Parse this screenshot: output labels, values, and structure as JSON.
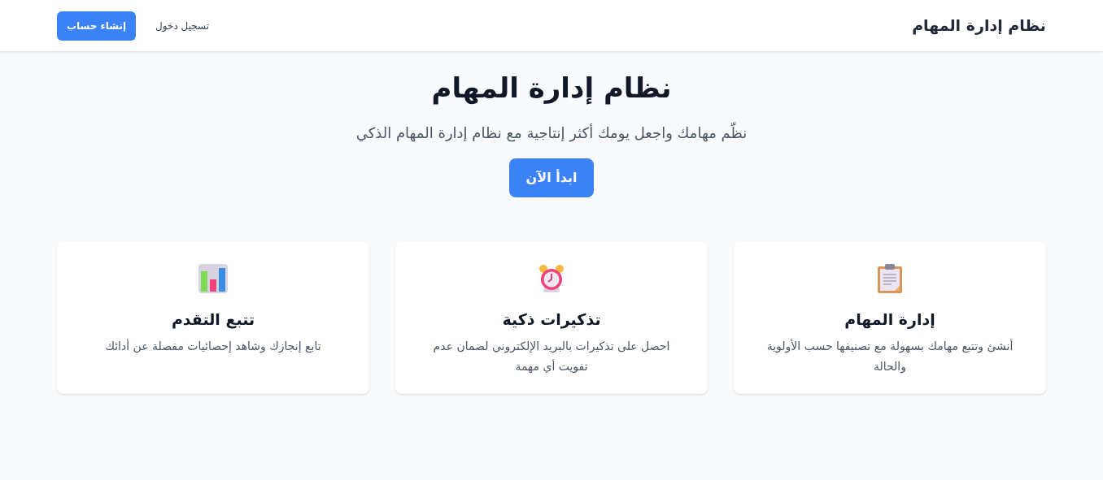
{
  "header": {
    "brand": "نظام إدارة المهام",
    "login": "تسجيل دخول",
    "signup": "إنشاء حساب"
  },
  "hero": {
    "title": "نظام إدارة المهام",
    "subtitle": "نظّم مهامك واجعل يومك أكثر إنتاجية مع نظام إدارة المهام الذكي",
    "cta": "ابدأ الآن"
  },
  "features": [
    {
      "kind": "clipboard",
      "title": "إدارة المهام",
      "text": "أنشئ وتتبع مهامك بسهولة مع تصنيفها حسب الأولوية والحالة"
    },
    {
      "kind": "alarm",
      "title": "تذكيرات ذكية",
      "text": "احصل على تذكيرات بالبريد الإلكتروني لضمان عدم تفويت أي مهمة"
    },
    {
      "kind": "chart",
      "title": "تتبع التقدم",
      "text": "تابع إنجازك وشاهد إحصائيات مفصلة عن أدائك"
    }
  ]
}
